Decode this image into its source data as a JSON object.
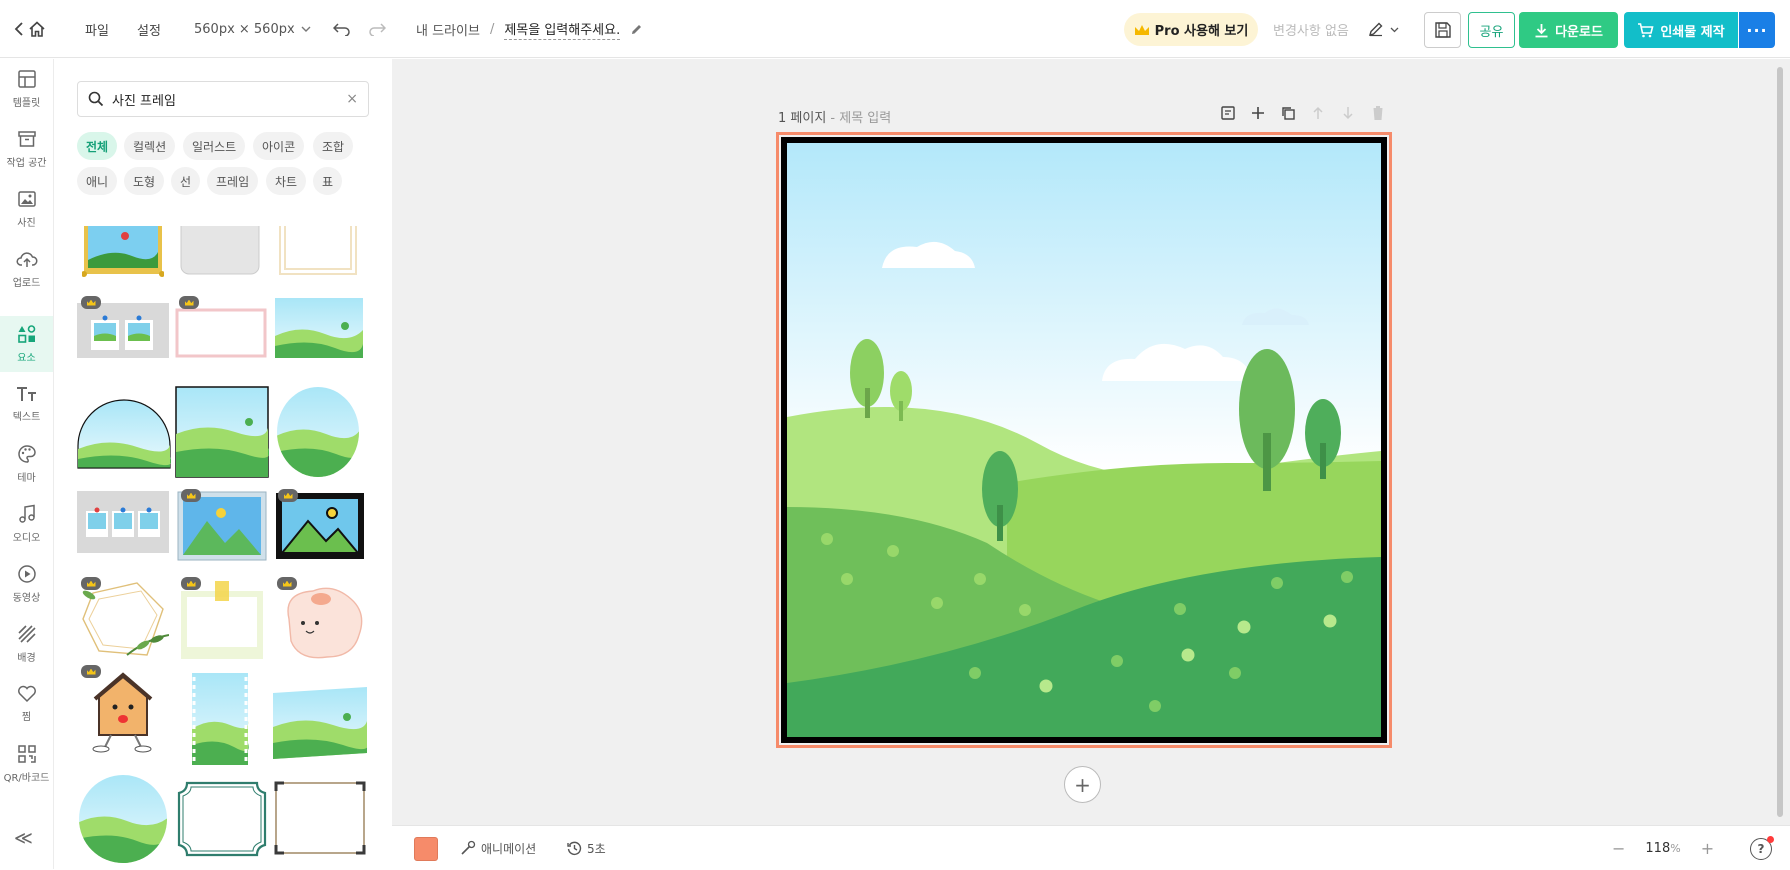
{
  "topbar": {
    "file_menu": "파일",
    "settings_menu": "설정",
    "canvas_size": "560px × 560px",
    "breadcrumb_root": "내 드라이브",
    "breadcrumb_sep": "/",
    "doc_title": "제목을 입력해주세요.",
    "pro_label": "Pro 사용해 보기",
    "save_status": "변경사항 없음",
    "share_label": "공유",
    "download_label": "다운로드",
    "print_label": "인쇄물 제작",
    "more_label": "···",
    "colors": {
      "download": "#2fca84",
      "print": "#12bec9",
      "more": "#1a7fe6",
      "share": "#2fc08f"
    }
  },
  "rail": {
    "items": [
      {
        "label": "템플릿",
        "icon": "template-icon"
      },
      {
        "label": "작업 공간",
        "icon": "archive-icon"
      },
      {
        "label": "사진",
        "icon": "photo-icon"
      },
      {
        "label": "업로드",
        "icon": "upload-cloud-icon"
      },
      {
        "label": "요소",
        "icon": "elements-icon"
      },
      {
        "label": "텍스트",
        "icon": "text-icon"
      },
      {
        "label": "테마",
        "icon": "palette-icon"
      },
      {
        "label": "오디오",
        "icon": "music-note-icon"
      },
      {
        "label": "동영상",
        "icon": "play-circle-icon"
      },
      {
        "label": "배경",
        "icon": "background-pattern-icon"
      },
      {
        "label": "찜",
        "icon": "heart-icon"
      },
      {
        "label": "QR/바코드",
        "icon": "qr-code-icon"
      }
    ],
    "active_index": 4,
    "collapse": "≪"
  },
  "panel": {
    "search_value": "사진 프레임",
    "search_clear": "×",
    "chips": [
      "전체",
      "컬렉션",
      "일러스트",
      "아이콘",
      "조합",
      "애니",
      "도형",
      "선",
      "프레임",
      "차트",
      "표"
    ],
    "active_chip": 0
  },
  "canvas": {
    "page_label": "1 페이지",
    "page_title_placeholder": " - 제목 입력",
    "add_page": "+",
    "frame_color": "#f68b6a"
  },
  "bottombar": {
    "animation_label": "애니메이션",
    "duration_label": "5초",
    "zoom_value": "118",
    "zoom_unit": "%",
    "zoom_minus": "−",
    "zoom_plus": "+",
    "help": "?"
  }
}
